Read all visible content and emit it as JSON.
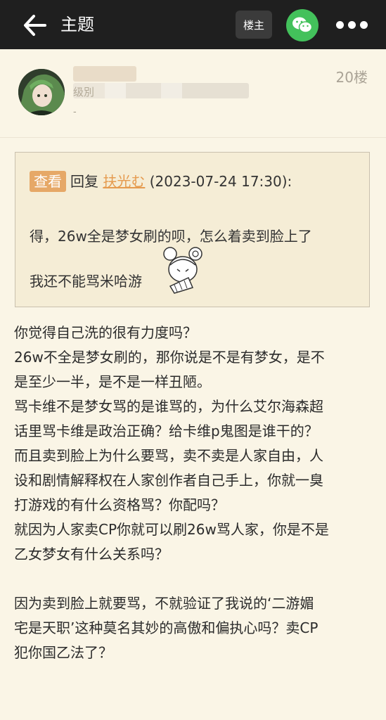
{
  "header": {
    "title": "主题",
    "louzhu_label": "楼主"
  },
  "post": {
    "username_hidden": "",
    "level_text": "级別",
    "dash_text": "-",
    "floor": "20楼"
  },
  "quote": {
    "view_label": "查看",
    "reply_label": "回复",
    "reply_user": "扶光む",
    "reply_time": "(2023-07-24 17:30):",
    "line1": "得，26w全是梦女刷的呗，怎么着卖到脸上了",
    "line2": "我还不能骂米哈游"
  },
  "content": {
    "lines": [
      "你觉得自己洗的很有力度吗？",
      "26w不全是梦女刷的，那你说是不是有梦女，是不",
      "是至少一半，是不是一样丑陋。",
      "骂卡维不是梦女骂的是谁骂的，为什么艾尔海森超",
      "话里骂卡维是政治正确？给卡维p鬼图是谁干的？",
      "而且卖到脸上为什么要骂，卖不卖是人家自由，人",
      "设和剧情解释权在人家创作者自己手上，你就一臭",
      "打游戏的有什么资格骂？你配吗？",
      "就因为人家卖CP你就可以刷26w骂人家，你是不是",
      "乙女梦女有什么关系吗？"
    ],
    "lines2": [
      "因为卖到脸上就要骂，不就验证了我说的‘二游媚",
      "宅是天职’这种莫名其妙的高傲和偏执心吗？卖CP",
      "犯你国乙法了？"
    ]
  },
  "icons": {
    "back": "arrow-left-icon",
    "wechat": "wechat-icon",
    "more": "more-dots-icon"
  }
}
